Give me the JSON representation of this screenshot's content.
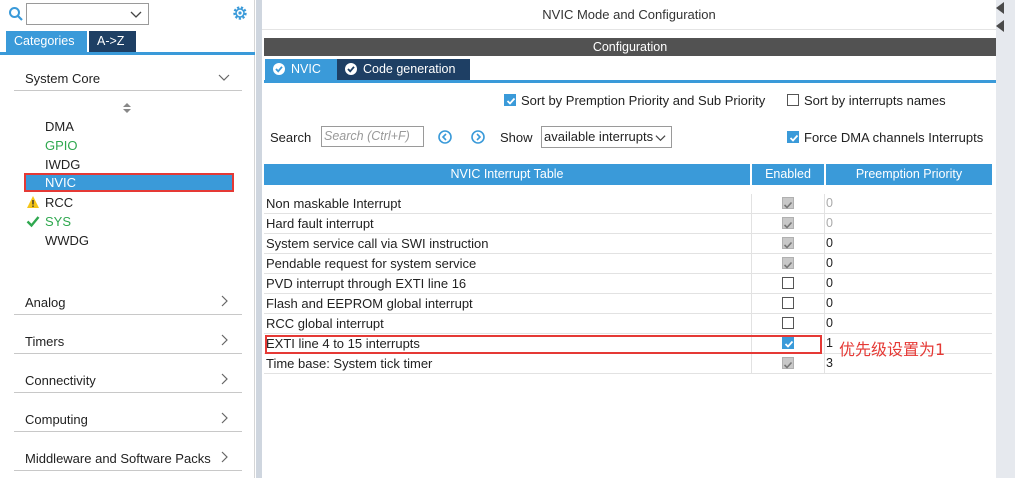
{
  "left": {
    "search_combo_value": "",
    "tabs": {
      "categories": "Categories",
      "az": "A->Z"
    },
    "sections": [
      {
        "label": "System Core",
        "expanded": true
      },
      {
        "label": "Analog",
        "expanded": false
      },
      {
        "label": "Timers",
        "expanded": false
      },
      {
        "label": "Connectivity",
        "expanded": false
      },
      {
        "label": "Computing",
        "expanded": false
      },
      {
        "label": "Middleware and Software Packs",
        "expanded": false
      }
    ],
    "system_core_items": [
      {
        "label": "DMA",
        "status": "none"
      },
      {
        "label": "GPIO",
        "status": "configured"
      },
      {
        "label": "IWDG",
        "status": "none"
      },
      {
        "label": "NVIC",
        "status": "selected"
      },
      {
        "label": "RCC",
        "status": "warning"
      },
      {
        "label": "SYS",
        "status": "ok"
      },
      {
        "label": "WWDG",
        "status": "none"
      }
    ]
  },
  "right": {
    "title": "NVIC Mode and Configuration",
    "config_label": "Configuration",
    "tabs": [
      {
        "label": "NVIC",
        "active": true
      },
      {
        "label": "Code generation",
        "active": false
      }
    ],
    "options": {
      "sort_premption": {
        "label": "Sort by Premption Priority and Sub Priority",
        "checked": true
      },
      "sort_names": {
        "label": "Sort by interrupts names",
        "checked": false
      },
      "force_dma": {
        "label": "Force DMA channels Interrupts",
        "checked": true
      }
    },
    "search": {
      "label": "Search",
      "placeholder": "Search (Ctrl+F)"
    },
    "show": {
      "label": "Show",
      "value": "available interrupts"
    },
    "table": {
      "headers": [
        "NVIC Interrupt Table",
        "Enabled",
        "Preemption Priority"
      ],
      "rows": [
        {
          "name": "Non maskable Interrupt",
          "enabled": "locked",
          "priority": "0",
          "dim": true
        },
        {
          "name": "Hard fault interrupt",
          "enabled": "locked",
          "priority": "0",
          "dim": true
        },
        {
          "name": "System service call via SWI instruction",
          "enabled": "locked",
          "priority": "0",
          "dim": false
        },
        {
          "name": "Pendable request for system service",
          "enabled": "locked",
          "priority": "0",
          "dim": false
        },
        {
          "name": "PVD interrupt through EXTI line 16",
          "enabled": "off",
          "priority": "0",
          "dim": false
        },
        {
          "name": "Flash and EEPROM global interrupt",
          "enabled": "off",
          "priority": "0",
          "dim": false
        },
        {
          "name": "RCC global interrupt",
          "enabled": "off",
          "priority": "0",
          "dim": false
        },
        {
          "name": "EXTI line 4 to 15 interrupts",
          "enabled": "on",
          "priority": "1",
          "dim": false
        },
        {
          "name": "Time base: System tick timer",
          "enabled": "locked",
          "priority": "3",
          "dim": false
        }
      ]
    },
    "annotation": "优先级设置为1"
  },
  "colors": {
    "accent": "#3a9ad9",
    "dark_tab": "#1e3f64",
    "highlight": "#e53935",
    "ok_green": "#2fa84f",
    "warning": "#f5c518"
  }
}
